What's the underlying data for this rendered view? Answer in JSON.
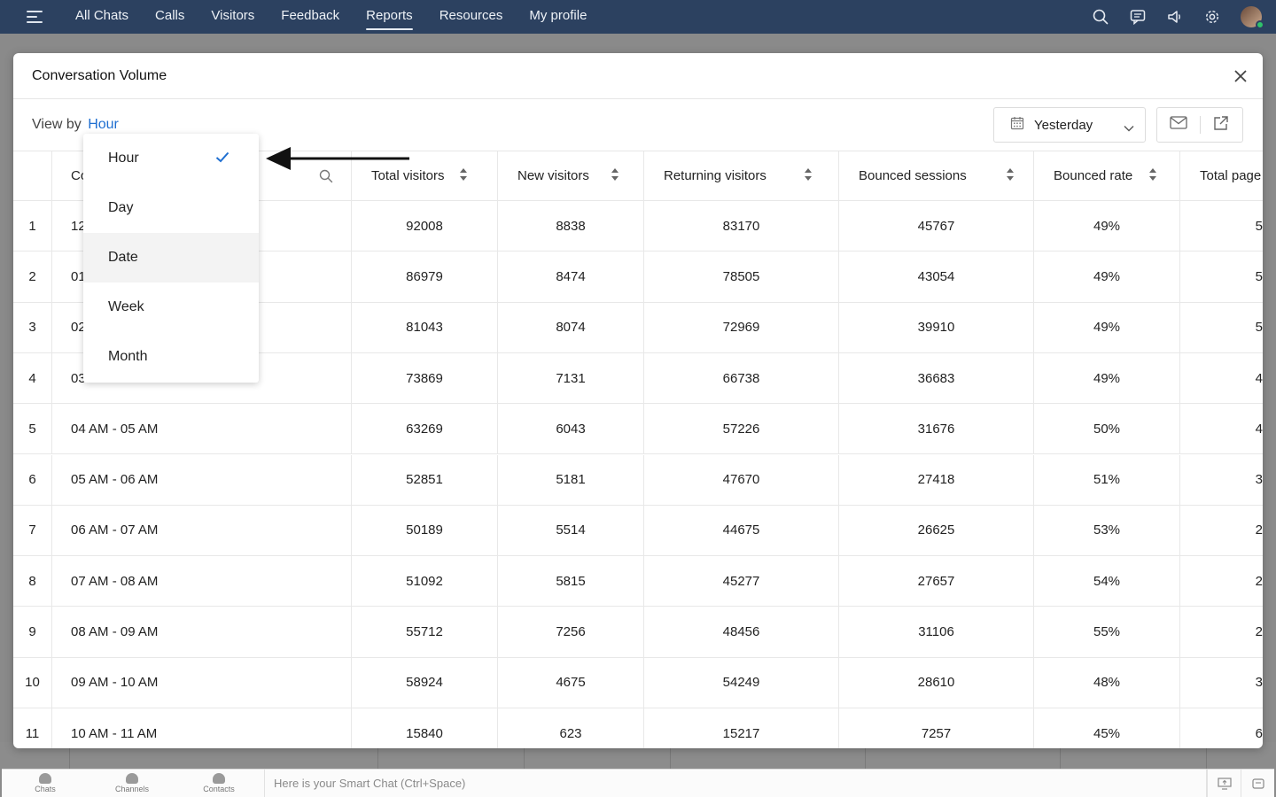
{
  "topnav": {
    "items": [
      {
        "label": "All Chats",
        "active": false
      },
      {
        "label": "Calls",
        "active": false
      },
      {
        "label": "Visitors",
        "active": false
      },
      {
        "label": "Feedback",
        "active": false
      },
      {
        "label": "Reports",
        "active": true
      },
      {
        "label": "Resources",
        "active": false
      },
      {
        "label": "My profile",
        "active": false
      }
    ],
    "icons": [
      "menu-icon",
      "search-icon",
      "chat-icon",
      "announcement-icon",
      "gear-icon",
      "avatar"
    ]
  },
  "modal": {
    "title": "Conversation Volume",
    "view_by_label": "View by",
    "view_by_value": "Hour",
    "date_range": "Yesterday"
  },
  "dropdown": {
    "options": [
      "Hour",
      "Day",
      "Date",
      "Week",
      "Month"
    ],
    "selected": "Hour",
    "hovered": "Date"
  },
  "table": {
    "columns": [
      "Co",
      "Total visitors",
      "New visitors",
      "Returning visitors",
      "Bounced sessions",
      "Bounced rate",
      "Total page"
    ],
    "rows": [
      {
        "n": "1",
        "time": "12",
        "total": "92008",
        "new": "8838",
        "returning": "83170",
        "bounced": "45767",
        "rate": "49%",
        "pages": "5"
      },
      {
        "n": "2",
        "time": "01",
        "total": "86979",
        "new": "8474",
        "returning": "78505",
        "bounced": "43054",
        "rate": "49%",
        "pages": "5"
      },
      {
        "n": "3",
        "time": "02",
        "total": "81043",
        "new": "8074",
        "returning": "72969",
        "bounced": "39910",
        "rate": "49%",
        "pages": "5"
      },
      {
        "n": "4",
        "time": "03",
        "total": "73869",
        "new": "7131",
        "returning": "66738",
        "bounced": "36683",
        "rate": "49%",
        "pages": "4"
      },
      {
        "n": "5",
        "time": "04 AM - 05 AM",
        "total": "63269",
        "new": "6043",
        "returning": "57226",
        "bounced": "31676",
        "rate": "50%",
        "pages": "4"
      },
      {
        "n": "6",
        "time": "05 AM - 06 AM",
        "total": "52851",
        "new": "5181",
        "returning": "47670",
        "bounced": "27418",
        "rate": "51%",
        "pages": "3"
      },
      {
        "n": "7",
        "time": "06 AM - 07 AM",
        "total": "50189",
        "new": "5514",
        "returning": "44675",
        "bounced": "26625",
        "rate": "53%",
        "pages": "2"
      },
      {
        "n": "8",
        "time": "07 AM - 08 AM",
        "total": "51092",
        "new": "5815",
        "returning": "45277",
        "bounced": "27657",
        "rate": "54%",
        "pages": "2"
      },
      {
        "n": "9",
        "time": "08 AM - 09 AM",
        "total": "55712",
        "new": "7256",
        "returning": "48456",
        "bounced": "31106",
        "rate": "55%",
        "pages": "2"
      },
      {
        "n": "10",
        "time": "09 AM - 10 AM",
        "total": "58924",
        "new": "4675",
        "returning": "54249",
        "bounced": "28610",
        "rate": "48%",
        "pages": "3"
      },
      {
        "n": "11",
        "time": "10 AM - 11 AM",
        "total": "15840",
        "new": "623",
        "returning": "15217",
        "bounced": "7257",
        "rate": "45%",
        "pages": "6"
      }
    ]
  },
  "bottombar": {
    "items": [
      {
        "label": "Chats",
        "icon": "chats-icon"
      },
      {
        "label": "Channels",
        "icon": "channels-icon"
      },
      {
        "label": "Contacts",
        "icon": "contacts-icon"
      }
    ],
    "smart_chat_placeholder": "Here is your Smart Chat (Ctrl+Space)"
  },
  "colors": {
    "nav_bg": "#2c4160",
    "link": "#1f6fd1",
    "check": "#1f6fd1"
  }
}
